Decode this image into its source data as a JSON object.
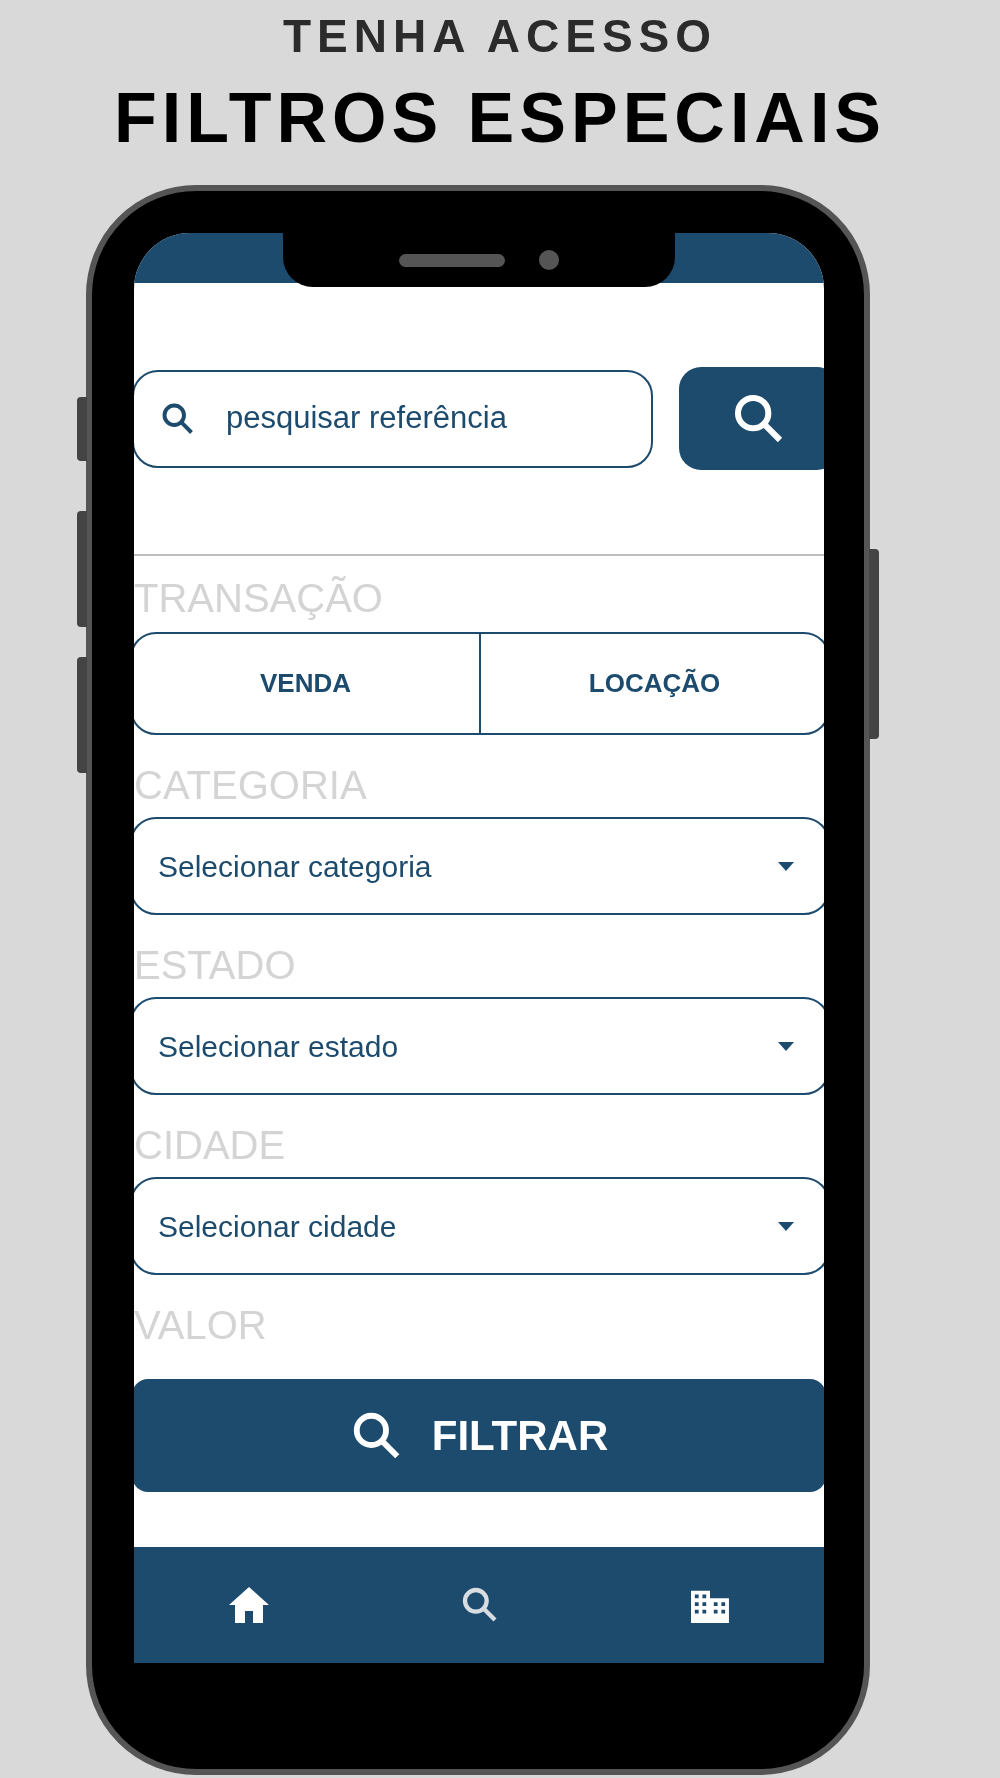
{
  "header": {
    "kicker": "TENHA ACESSO",
    "title": "FILTROS ESPECIAIS"
  },
  "search": {
    "placeholder": "pesquisar referência"
  },
  "transaction": {
    "label": "TRANSAÇÃO",
    "options": [
      {
        "label": "VENDA"
      },
      {
        "label": "LOCAÇÃO"
      }
    ]
  },
  "filters": [
    {
      "label": "CATEGORIA",
      "placeholder": "Selecionar categoria"
    },
    {
      "label": "ESTADO",
      "placeholder": "Selecionar estado"
    },
    {
      "label": "CIDADE",
      "placeholder": "Selecionar cidade"
    }
  ],
  "value": {
    "label": "VALOR"
  },
  "filter_button": {
    "label": "FILTRAR"
  }
}
